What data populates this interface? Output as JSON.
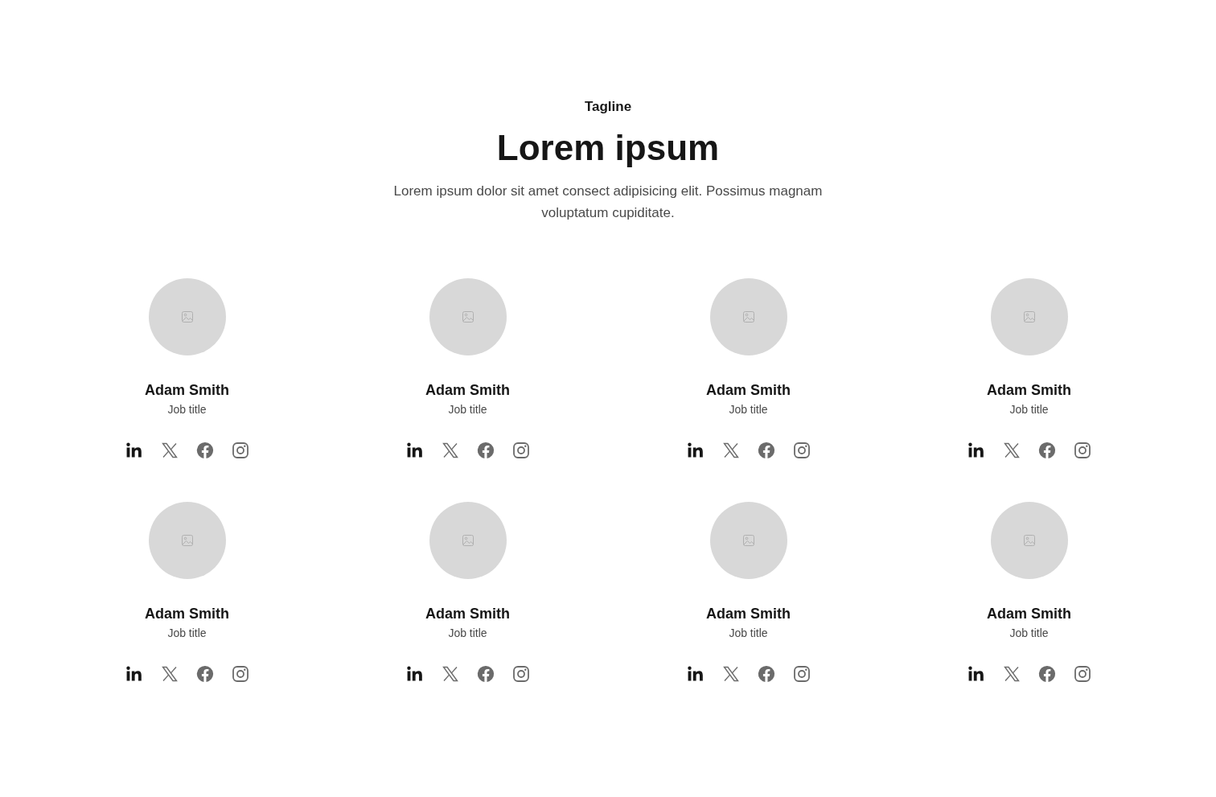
{
  "header": {
    "tagline": "Tagline",
    "title": "Lorem ipsum",
    "description": "Lorem ipsum dolor sit amet consect adipisicing elit. Possimus magnam voluptatum cupiditate."
  },
  "members": [
    {
      "name": "Adam Smith",
      "job_title": "Job title"
    },
    {
      "name": "Adam Smith",
      "job_title": "Job title"
    },
    {
      "name": "Adam Smith",
      "job_title": "Job title"
    },
    {
      "name": "Adam Smith",
      "job_title": "Job title"
    },
    {
      "name": "Adam Smith",
      "job_title": "Job title"
    },
    {
      "name": "Adam Smith",
      "job_title": "Job title"
    },
    {
      "name": "Adam Smith",
      "job_title": "Job title"
    },
    {
      "name": "Adam Smith",
      "job_title": "Job title"
    }
  ]
}
